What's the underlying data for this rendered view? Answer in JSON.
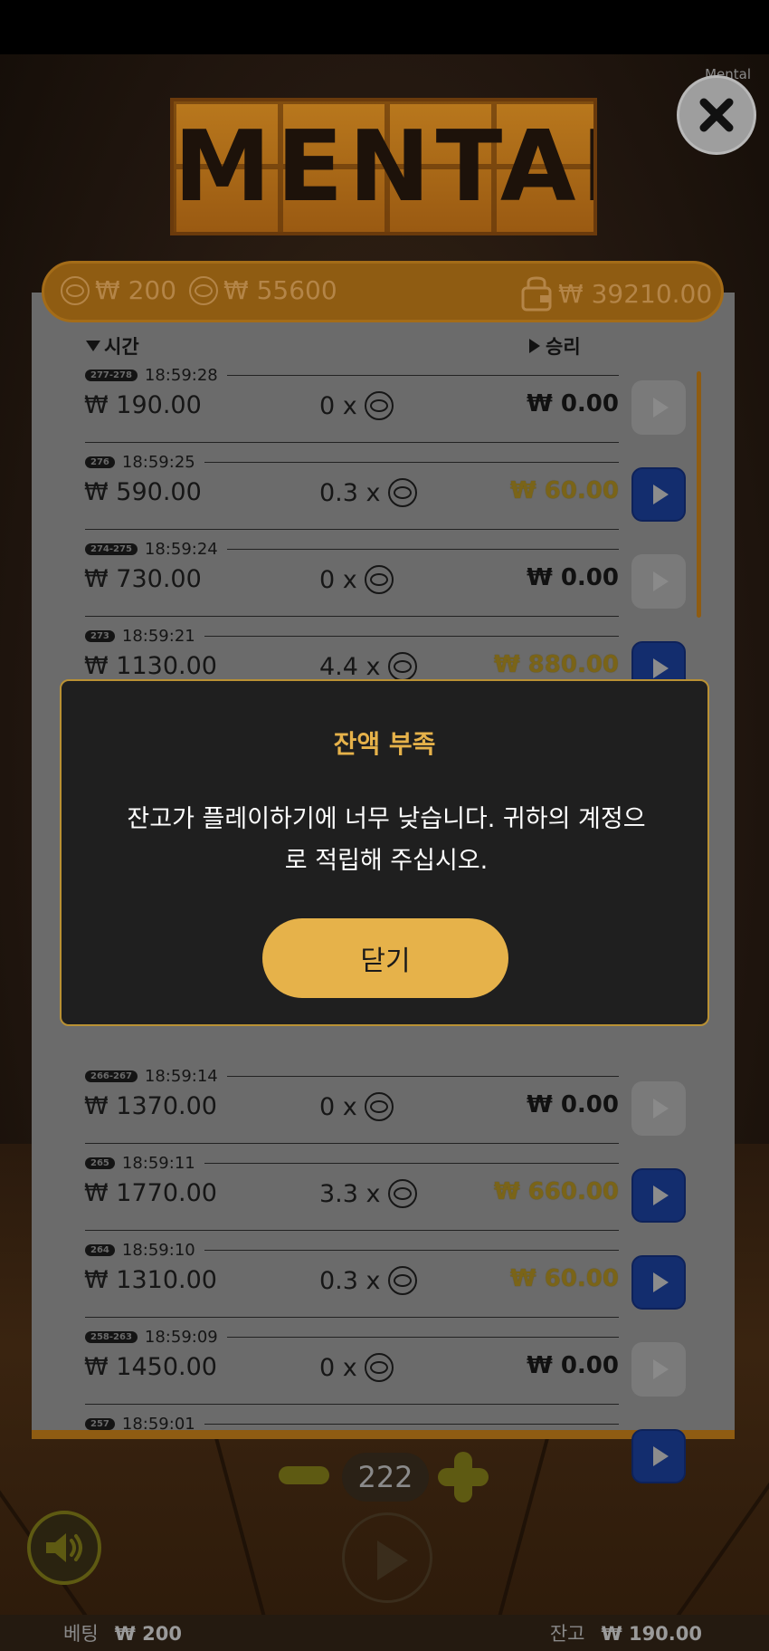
{
  "app": {
    "corner_label": "Mental",
    "logo_text": "MENTAL"
  },
  "balance_bar": {
    "bet_amount": "₩ 200",
    "max_win": "₩ 55600",
    "wallet_balance": "₩ 39210.00"
  },
  "history": {
    "col_time": "시간",
    "col_win": "승리",
    "rows": [
      {
        "round": "277-278",
        "time": "18:59:28",
        "bet": "₩ 190.00",
        "mult": "0 x",
        "win": "₩ 0.00",
        "win_gold": false,
        "replay": false
      },
      {
        "round": "276",
        "time": "18:59:25",
        "bet": "₩ 590.00",
        "mult": "0.3 x",
        "win": "₩ 60.00",
        "win_gold": true,
        "replay": true
      },
      {
        "round": "274-275",
        "time": "18:59:24",
        "bet": "₩ 730.00",
        "mult": "0 x",
        "win": "₩ 0.00",
        "win_gold": false,
        "replay": false
      },
      {
        "round": "273",
        "time": "18:59:21",
        "bet": "₩ 1130.00",
        "mult": "4.4 x",
        "win": "₩ 880.00",
        "win_gold": true,
        "replay": true
      },
      {
        "round": "266-267",
        "time": "18:59:14",
        "bet": "₩ 1370.00",
        "mult": "0 x",
        "win": "₩ 0.00",
        "win_gold": false,
        "replay": false
      },
      {
        "round": "265",
        "time": "18:59:11",
        "bet": "₩ 1770.00",
        "mult": "3.3 x",
        "win": "₩ 660.00",
        "win_gold": true,
        "replay": true
      },
      {
        "round": "264",
        "time": "18:59:10",
        "bet": "₩ 1310.00",
        "mult": "0.3 x",
        "win": "₩ 60.00",
        "win_gold": true,
        "replay": true
      },
      {
        "round": "258-263",
        "time": "18:59:09",
        "bet": "₩ 1450.00",
        "mult": "0 x",
        "win": "₩ 0.00",
        "win_gold": false,
        "replay": false
      },
      {
        "round": "257",
        "time": "18:59:01",
        "bet": "",
        "mult": "",
        "win": "",
        "win_gold": false,
        "replay": true
      }
    ]
  },
  "modal": {
    "title": "잔액 부족",
    "message_line1": "잔고가 플레이하기에 너무 낮습니다. 귀하의 계정으",
    "message_line2": "로 적립해 주십시오.",
    "close_label": "닫기"
  },
  "controls": {
    "stepper_value": "222"
  },
  "footer": {
    "bet_label": "베팅",
    "bet_value": "₩ 200",
    "balance_label": "잔고",
    "balance_value": "₩ 190.00"
  },
  "colors": {
    "accent_gold": "#e6b24a",
    "win_gold": "#e0b830",
    "replay_blue": "#2e5ee0"
  },
  "icons": [
    "close-icon",
    "coin-icon",
    "wallet-icon",
    "play-icon",
    "speaker-icon",
    "minus-icon",
    "plus-icon"
  ]
}
